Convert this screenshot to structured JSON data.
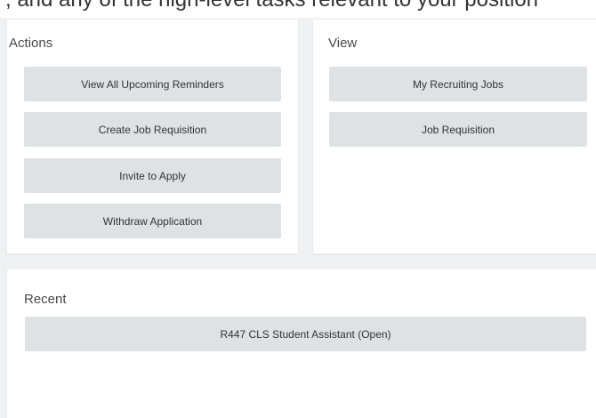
{
  "header": {
    "partial_text": ", and any of the high-level tasks relevant to your position"
  },
  "actions": {
    "title": "Actions",
    "buttons": [
      "View All Upcoming Reminders",
      "Create Job Requisition",
      "Invite to Apply",
      "Withdraw Application"
    ]
  },
  "view": {
    "title": "View",
    "buttons": [
      "My Recruiting Jobs",
      "Job Requisition"
    ]
  },
  "recent": {
    "title": "Recent",
    "items": [
      "R447 CLS Student Assistant (Open)"
    ]
  },
  "colors": {
    "page_background": "#f0f1f2",
    "card_background": "#ffffff",
    "button_background": "#dfe2e5",
    "text": "#333333"
  }
}
